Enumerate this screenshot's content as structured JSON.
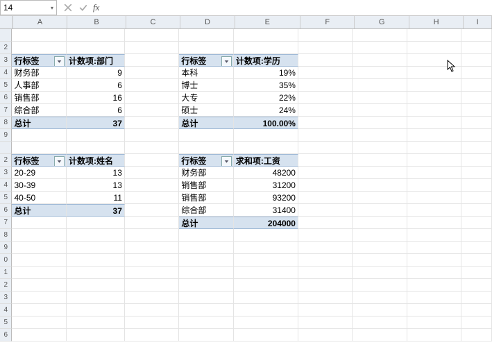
{
  "namebox": {
    "ref": "14"
  },
  "formula_bar": {
    "value": ""
  },
  "column_headers": [
    "A",
    "B",
    "C",
    "D",
    "E",
    "F",
    "G",
    "H",
    "I"
  ],
  "row_headers": [
    " ",
    "2",
    "3",
    "4",
    "5",
    "6",
    "7",
    "8",
    "9",
    " ",
    "2",
    "3",
    "4",
    "5",
    "6",
    "7",
    "8",
    "9",
    "0",
    "1",
    "2",
    "3",
    "4",
    "5",
    "6"
  ],
  "pivot_dept": {
    "row_label_hdr": "行标签",
    "val_hdr": "计数项:部门",
    "rows": [
      {
        "label": "财务部",
        "value": "9"
      },
      {
        "label": "人事部",
        "value": "6"
      },
      {
        "label": "销售部",
        "value": "16"
      },
      {
        "label": "综合部",
        "value": "6"
      }
    ],
    "total_label": "总计",
    "total_value": "37"
  },
  "pivot_edu": {
    "row_label_hdr": "行标签",
    "val_hdr": "计数项:学历",
    "rows": [
      {
        "label": "本科",
        "value": "19%"
      },
      {
        "label": "博士",
        "value": "35%"
      },
      {
        "label": "大专",
        "value": "22%"
      },
      {
        "label": "硕士",
        "value": "24%"
      }
    ],
    "total_label": "总计",
    "total_value": "100.00%"
  },
  "pivot_name": {
    "row_label_hdr": "行标签",
    "val_hdr": "计数项:姓名",
    "rows": [
      {
        "label": "20-29",
        "value": "13"
      },
      {
        "label": "30-39",
        "value": "13"
      },
      {
        "label": "40-50",
        "value": "11"
      }
    ],
    "total_label": "总计",
    "total_value": "37"
  },
  "pivot_salary": {
    "row_label_hdr": "行标签",
    "val_hdr": "求和项:工资",
    "rows": [
      {
        "label": "财务部",
        "value": "48200"
      },
      {
        "label": "销售部",
        "value": "31200"
      },
      {
        "label": "销售部",
        "value": "93200"
      },
      {
        "label": "综合部",
        "value": "31400"
      }
    ],
    "total_label": "总计",
    "total_value": "204000"
  }
}
